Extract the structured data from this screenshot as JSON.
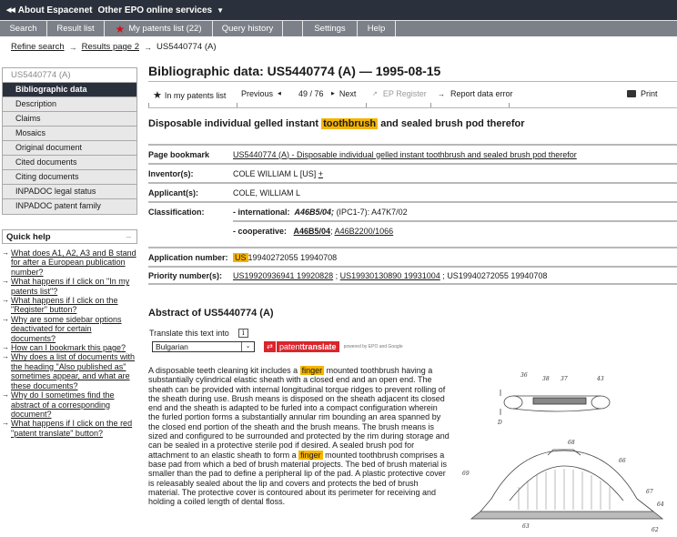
{
  "topbar": {
    "about": "About Espacenet",
    "services": "Other EPO online services"
  },
  "tabs": [
    {
      "label": "Search"
    },
    {
      "label": "Result list"
    },
    {
      "label": "My patents list (22)"
    },
    {
      "label": "Query history"
    },
    {
      "label": ""
    },
    {
      "label": "Settings"
    },
    {
      "label": "Help"
    }
  ],
  "breadcrumb": {
    "refine": "Refine search",
    "results": "Results page 2",
    "current": "US5440774 (A)"
  },
  "sidebar": {
    "header": "US5440774  (A)",
    "items": [
      {
        "label": "Bibliographic data",
        "active": true
      },
      {
        "label": "Description"
      },
      {
        "label": "Claims"
      },
      {
        "label": "Mosaics"
      },
      {
        "label": "Original document"
      },
      {
        "label": "Cited documents"
      },
      {
        "label": "Citing documents"
      },
      {
        "label": "INPADOC legal status"
      },
      {
        "label": "INPADOC patent family"
      }
    ]
  },
  "quick_help": {
    "title": "Quick help",
    "collapse": "–",
    "questions": [
      "What does A1, A2, A3 and B stand for after a European publication number?",
      "What happens if I click on \"In my patents list\"?",
      "What happens if I click on the \"Register\" button?",
      "Why are some sidebar options deactivated for certain documents?",
      "How can I bookmark this page?",
      "Why does a list of documents with the heading \"Also published as\" sometimes appear, and what are these documents?",
      "Why do I sometimes find the abstract of a corresponding document?",
      "What happens if I click on the red \"patent translate\" button?"
    ]
  },
  "main": {
    "title": "Bibliographic data: US5440774  (A) — 1995-08-15",
    "toolbar": {
      "patents_list": "In my patents list",
      "previous": "Previous",
      "counter": "49 / 76",
      "next": "Next",
      "ep_register": "EP Register",
      "report": "Report data error",
      "print": "Print"
    },
    "doc_title": {
      "before": "Disposable individual gelled instant",
      "highlight": "toothbrush",
      "after": "and sealed brush pod therefor"
    },
    "biblio": {
      "bookmark_label": "Page bookmark",
      "bookmark_value": "US5440774  (A)  -  Disposable individual gelled instant toothbrush and sealed brush pod therefor",
      "inventor_label": "Inventor(s):",
      "inventor_value": "COLE WILLIAM L [US]",
      "inventor_more": "+",
      "applicant_label": "Applicant(s):",
      "applicant_value": "COLE, WILLIAM L",
      "classification_label": "Classification:",
      "intl_label": "- international:",
      "intl_main": "A46B5/04;",
      "intl_rest": "(IPC1-7): A47K7/02",
      "coop_label": "- cooperative:",
      "coop_1": "A46B5/04",
      "coop_sep": ";",
      "coop_2": "A46B2200/1066",
      "appnum_label": "Application number:",
      "appnum_highlight": "US",
      "appnum_value": "19940272055 19940708",
      "priority_label": "Priority number(s):",
      "priority_1": "US19920936941 19920828",
      "priority_2": "US19930130890 19931004",
      "priority_3": "US19940272055 19940708",
      "priority_sep": ";"
    },
    "abstract": {
      "title": "Abstract of  US5440774  (A)",
      "translate_label": "Translate this text into",
      "info": "i",
      "language": "Bulgarian",
      "pt_normal": "patent",
      "pt_bold": "translate",
      "powered": "powered by EPO and Google",
      "text_1": "A disposable teeth cleaning kit includes a",
      "hl_1": "finger",
      "text_2": "mounted toothbrush having a substantially cylindrical elastic sheath with a closed end and an open end. The sheath can be provided with internal longitudinal torque ridges to prevent rolling of the sheath during use. Brush means is disposed on the sheath adjacent its closed end and the sheath is adapted to be furled into a compact configuration wherein the furled portion forms a substantially annular rim bounding an area spanned by the closed end portion of the sheath and the brush means. The brush means is sized and configured to be surrounded and protected by the rim during storage and can be sealed in a protective sterile pod if desired. A sealed brush pod for attachment to an elastic sheath to form a",
      "hl_2": "finger",
      "text_3": "mounted toothbrush comprises a base pad from which a bed of brush material projects. The bed of brush material is smaller than the pad to define a peripheral lip of the pad. A plastic protective cover is releasably sealed about the lip and covers and protects the bed of brush material. The protective cover is contoured about its perimeter for receiving and holding a coiled length of dental floss."
    },
    "figure_labels": [
      "36",
      "38",
      "37",
      "43",
      "D",
      "68",
      "66",
      "69",
      "67",
      "64",
      "63",
      "62"
    ]
  },
  "icons": {
    "back": "◀",
    "caret": "▼",
    "star": "★",
    "arrow": "→",
    "prev": "◀",
    "next": "▶",
    "external": "↗",
    "print": "⎙",
    "select_arrow": "⌄",
    "swap": "⇄"
  },
  "colors": {
    "topbar": "#2b313c",
    "tabs": "#7c8189",
    "highlight": "#f5b400",
    "active_nav": "#2b313c",
    "patenttranslate": "#d9252c",
    "star": "#d0101a"
  }
}
